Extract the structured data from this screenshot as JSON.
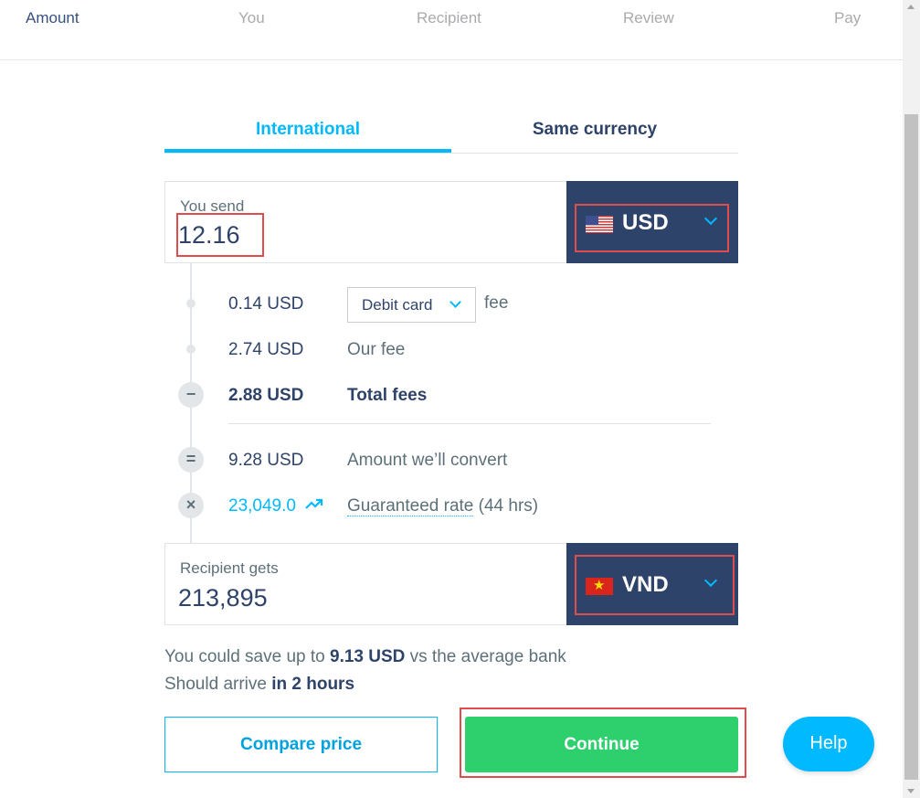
{
  "stepper": {
    "steps": [
      "Amount",
      "You",
      "Recipient",
      "Review",
      "Pay"
    ],
    "active_step": "Amount"
  },
  "tabs": {
    "international": "International",
    "same_currency": "Same currency",
    "active": "International"
  },
  "send": {
    "label": "You send",
    "amount": "12.16",
    "currency": "USD",
    "flag": "us-flag-icon"
  },
  "fees": {
    "payment_fee_amount": "0.14 USD",
    "payment_method": "Debit card",
    "payment_fee_suffix": "fee",
    "our_fee_amount": "2.74 USD",
    "our_fee_label": "Our fee",
    "total_fees_amount": "2.88 USD",
    "total_fees_label": "Total fees",
    "total_op": "−",
    "convert_amount": "9.28 USD",
    "convert_label": "Amount we’ll convert",
    "convert_op": "=",
    "rate_value": "23,049.0",
    "rate_label": "Guaranteed rate",
    "rate_duration": "(44 hrs)",
    "rate_op": "×"
  },
  "receive": {
    "label": "Recipient gets",
    "amount": "213,895",
    "currency": "VND",
    "flag": "vn-flag-icon"
  },
  "summary": {
    "save_prefix": "You could save up to",
    "save_amount": "9.13 USD",
    "save_suffix": "vs the average bank",
    "arrive_prefix": "Should arrive",
    "arrive_time": "in 2 hours"
  },
  "actions": {
    "compare_label": "Compare price",
    "continue_label": "Continue",
    "help_label": "Help"
  },
  "colors": {
    "accent": "#00b9ff",
    "navy": "#2e4369",
    "continue_green": "#2ed06e",
    "highlight_red": "#e04b4b"
  }
}
